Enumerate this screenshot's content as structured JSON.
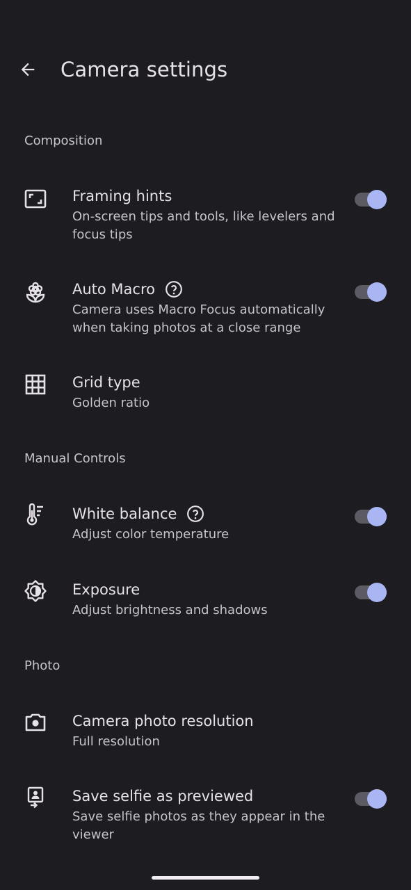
{
  "header": {
    "title": "Camera settings",
    "back_icon": "arrow-back-icon"
  },
  "colors": {
    "background": "#1d1c21",
    "toggle_thumb": "#aab6f4",
    "toggle_track": "#5c5b63"
  },
  "sections": {
    "composition": {
      "title": "Composition",
      "framing_hints": {
        "label": "Framing hints",
        "sub": "On-screen tips and tools, like levelers and focus tips",
        "toggle": "on",
        "icon": "framing-icon"
      },
      "auto_macro": {
        "label": "Auto Macro",
        "sub": "Camera uses Macro Focus automatically when taking photos at a close range",
        "toggle": "on",
        "icon": "flower-icon",
        "help_icon": "help-circle-icon"
      },
      "grid_type": {
        "label": "Grid type",
        "sub": "Golden ratio",
        "icon": "grid-icon"
      }
    },
    "manual_controls": {
      "title": "Manual Controls",
      "white_balance": {
        "label": "White balance",
        "sub": "Adjust color temperature",
        "toggle": "on",
        "icon": "thermometer-icon",
        "help_icon": "help-circle-icon"
      },
      "exposure": {
        "label": "Exposure",
        "sub": "Adjust brightness and shadows",
        "toggle": "on",
        "icon": "exposure-icon"
      }
    },
    "photo": {
      "title": "Photo",
      "resolution": {
        "label": "Camera photo resolution",
        "sub": "Full resolution",
        "icon": "camera-icon"
      },
      "save_selfie": {
        "label": "Save selfie as previewed",
        "sub": "Save selfie photos as they appear in the viewer",
        "toggle": "on",
        "icon": "selfie-icon"
      }
    }
  }
}
